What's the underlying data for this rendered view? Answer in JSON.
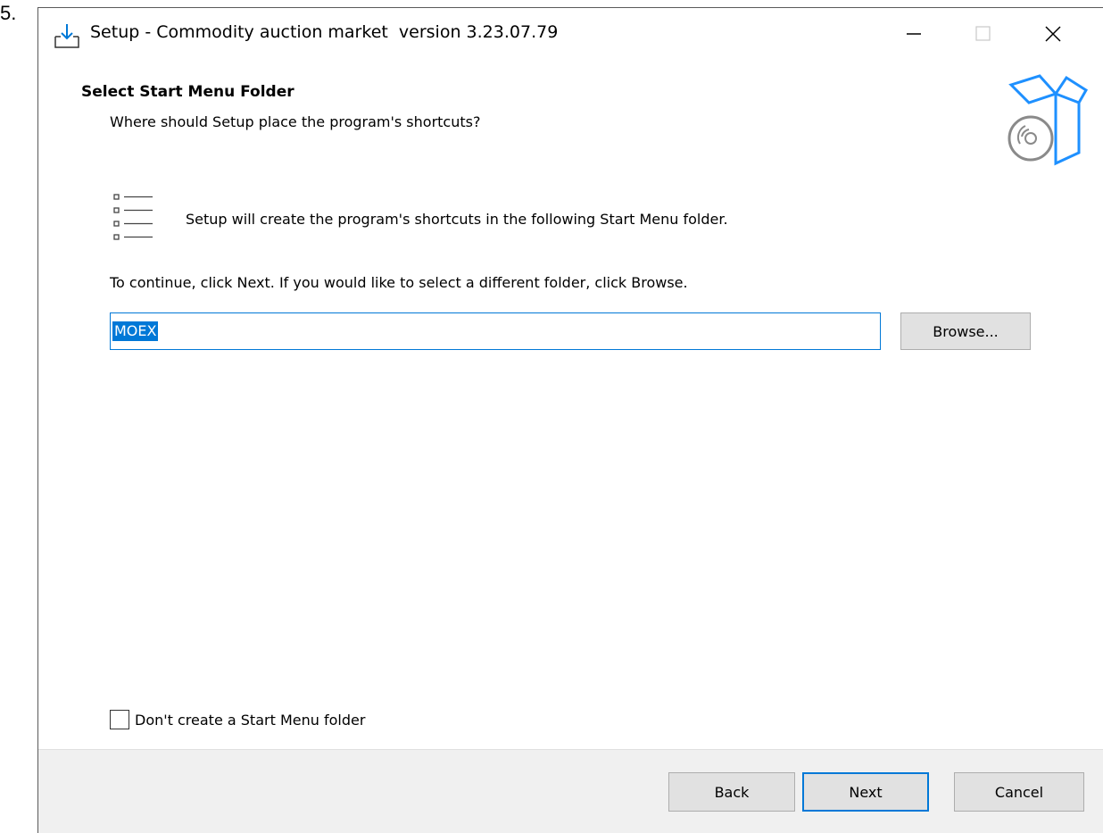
{
  "list_number": "5.",
  "window": {
    "title": "Setup - Commodity auction market  version 3.23.07.79",
    "icons": {
      "app": "installer-download-icon",
      "minimize": "minimize-icon",
      "maximize": "maximize-icon",
      "close": "close-icon"
    }
  },
  "header": {
    "title": "Select Start Menu Folder",
    "subtitle": "Where should Setup place the program's shortcuts?",
    "graphic": "software-box-disc-icon"
  },
  "body": {
    "info_text": "Setup will create the program's shortcuts in the following Start Menu folder.",
    "continue_text": "To continue, click Next. If you would like to select a different folder, click Browse.",
    "folder_value": "MOEX",
    "browse_label": "Browse...",
    "checkbox_label": "Don't create a Start Menu folder",
    "checkbox_checked": false
  },
  "footer": {
    "back_label": "Back",
    "next_label": "Next",
    "cancel_label": "Cancel"
  },
  "colors": {
    "accent": "#0078d7",
    "footer_bg": "#f0f0f0",
    "button_bg": "#e1e1e1"
  }
}
